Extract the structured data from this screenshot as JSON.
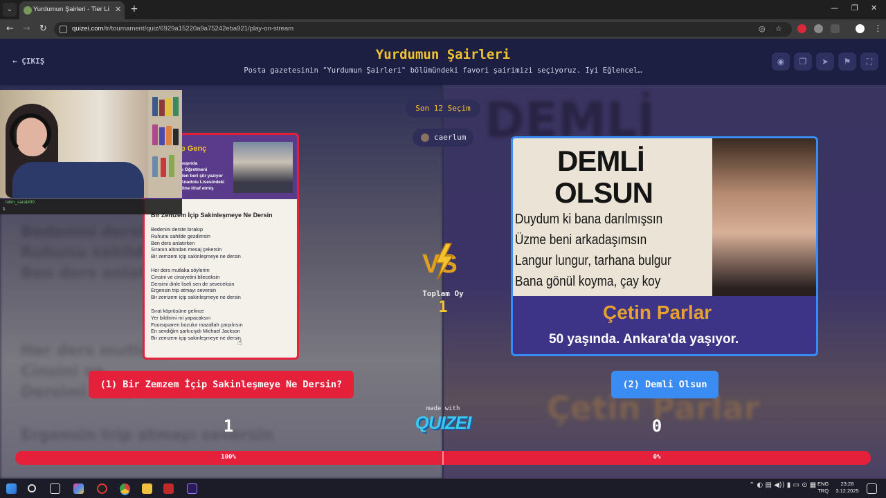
{
  "browser": {
    "tab_title": "Yurdumun Şairleri - Tier List, Ka",
    "url_domain": "quizei.com",
    "url_path": "/tr/tournament/quiz/6929a15220a9a75242eba921/play-on-stream"
  },
  "header": {
    "exit_label": "ÇIKIŞ",
    "title": "Yurdumun Şairleri",
    "subtitle": "Posta gazetesinin \"Yurdumun Şairleri\" bölümündeki favori şairimizi seçiyoruz. İyi Eğlencel…"
  },
  "round": {
    "recent_label": "Son 12 Seçim",
    "username": "caerlum"
  },
  "webcam": {
    "chat_name": "lolim_sarabi00",
    "chat_message": "1"
  },
  "left_card": {
    "poet_name_partial": "p Genç",
    "info_lines": [
      "yaşında",
      "u Öğretmeni",
      "den beri şiir yazıyor",
      "Anadolu Lisesindeki",
      "dine ithaf etmiş"
    ],
    "poem_title": "Bir Zemzem İçip Sakinleşmeye Ne Dersin",
    "stanzas": [
      [
        "Bedenini derste bırakıp",
        "Ruhunu sahilde gezdirirsin",
        "Ben ders anlatırken",
        "Sıranın altından mesaj çekersin",
        "Bir zemzem içip sakinleşmeye ne dersin"
      ],
      [
        "Her ders mutlaka söylerim",
        "Cinsini ve cinsiyetini bileceksin",
        "Dersimi dinle liseli sen de seveceksin",
        "Ergensin trip atmayı seversin",
        "Bir zemzem içip sakinleşmeye ne dersin"
      ],
      [
        "Sırat köprüsüne gelince",
        "Yer bildirimi mi yapacaksın",
        "Foursquaren bozulur mazallah çarpılırsın",
        "En sevdiğim şarkıcıydı Michael Jackson",
        "Bir zemzem içip sakinleşmeye ne dersin"
      ]
    ]
  },
  "right_card": {
    "heading_1": "DEMLİ",
    "heading_2": "OLSUN",
    "verses": [
      "Duydum ki bana darılmışsın",
      "Üzme beni arkadaşımsın",
      "Langur lungur, tarhana bulgur",
      "Bana gönül koyma, çay koy"
    ],
    "poet_name": "Çetin Parlar",
    "poet_info": "50 yaşında. Ankara'da yaşıyor."
  },
  "center": {
    "total_label": "Toplam Oy",
    "total_value": "1",
    "made_with": "made with",
    "brand": "QUIZEI"
  },
  "choices": {
    "left_label": "(1) Bir Zemzem İçip Sakinleşmeye Ne Dersin?",
    "right_label": "(2) Demli Olsun",
    "left_votes": "1",
    "right_votes": "0",
    "left_pct_label": "100%",
    "right_pct_label": "0%",
    "left_fraction": 1.0
  },
  "system": {
    "lang_1": "ENG",
    "lang_2": "TRQ",
    "time": "23:28",
    "date": "3.12.2025"
  },
  "colors": {
    "accent_gold": "#f4c430",
    "left_red": "#e5203a",
    "right_blue": "#3a8bf2"
  }
}
